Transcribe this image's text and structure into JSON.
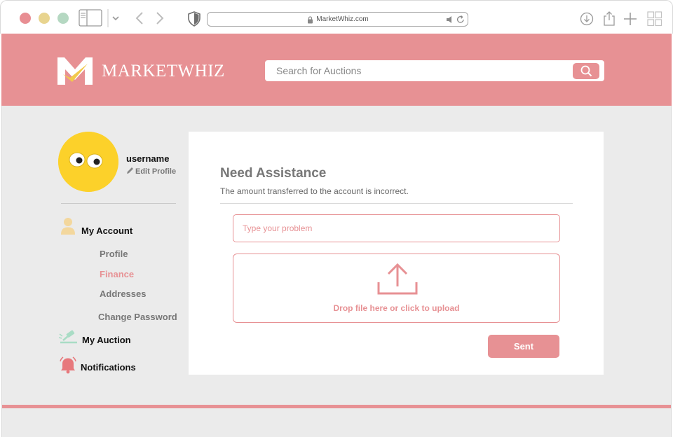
{
  "browser": {
    "url": "MarketWhiz.com"
  },
  "header": {
    "brand_name": "MARKETWHIZ",
    "search_placeholder": "Search for Auctions"
  },
  "sidebar": {
    "username": "username",
    "edit_profile": "Edit Profile",
    "my_account": "My Account",
    "sub_items": [
      "Profile",
      "Finance",
      "Addresses",
      "Change Password"
    ],
    "active_item": "Finance",
    "my_auction": "My Auction",
    "notifications": "Notifications"
  },
  "assistance": {
    "title": "Need Assistance",
    "subtitle": "The amount transferred to the account is incorrect.",
    "problem_placeholder": "Type your problem",
    "upload_text": "Drop file here or click to upload",
    "send_label": "Sent"
  },
  "colors": {
    "accent": "#e79194",
    "background": "#ebebeb",
    "logo_yellow": "#f2c94c"
  }
}
